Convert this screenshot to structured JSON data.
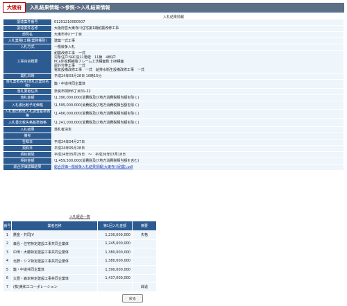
{
  "header": {
    "pref": "大阪府",
    "title": "入札結果情報->参照->入札結果情報"
  },
  "detail_section_title": "入札結果情報",
  "details": [
    {
      "label": "調達案件番号",
      "value": "01201210000507"
    },
    {
      "label": "調達案件名称",
      "value": "大阪府営大東寺川住宅第1期耐震改修工事"
    },
    {
      "label": "部局名",
      "value": "大東市寺川一丁目"
    },
    {
      "label": "入札業種(工種/業務種別)",
      "value": "建築一式工事"
    },
    {
      "label": "入札方式",
      "value": "一般競争入札"
    },
    {
      "label": "工事内容概要",
      "value": "耐震改修工事　一式\n対象住戸:SRC造11階建　11棟　480戸\nPCa外殻鋼補強フレーム工法構面数:198構面\n屋外付帯工事　一式\n電気設備改修工事　一式　給排水衛生設備改修工事　一式"
    },
    {
      "label": "開札日時",
      "value": "平成24年03月28日 10時15分"
    },
    {
      "label": "落札業者名称(落札企業体名称)",
      "value": "籠・中道共同企業体"
    },
    {
      "label": "落札業者住所",
      "value": "奈良市岡田6丁目31-22"
    },
    {
      "label": "落札金額",
      "value": "\\1,390,000,000(消費税及び地方消費税相当額を除く)"
    },
    {
      "label": "入札書比較予定価格",
      "value": "\\1,595,000,000(消費税及び地方消費税相当額を除く)"
    },
    {
      "label": "入札書比較低入札調査基準価格",
      "value": "\\1,406,000,000(消費税及び地方消費税相当額を除く)"
    },
    {
      "label": "入札書比較失格基準価格",
      "value": "\\1,241,000,000(消費税及び地方消費税相当額を除く)"
    },
    {
      "label": "入札結果",
      "value": "落札者決定"
    },
    {
      "label": "備考",
      "value": ""
    },
    {
      "label": "告知日",
      "value": "平成24年04月27日"
    },
    {
      "label": "契約日",
      "value": "平成24年05月28日"
    },
    {
      "label": "契約期間",
      "value": "平成24年05月29日　～　平成26年07月18日"
    },
    {
      "label": "契約金額",
      "value": "\\1,459,500,000(消費税及び地方消費税相当額を含む)"
    },
    {
      "label": "総合評価詳細結果",
      "value": "総合評価一般競争入札結果情報(大東寺川耐震).pdf",
      "link": true
    }
  ],
  "list_section_title": "入札経過一覧",
  "list": {
    "headers": {
      "no": "番号",
      "name": "業者名称",
      "amount": "第1回入札金額",
      "status": "摘要"
    },
    "rows": [
      {
        "no": "1",
        "name": "鷹金・共同JV",
        "amount": "1,230,000,000",
        "status": "失格"
      },
      {
        "no": "2",
        "name": "森島・住宅特定建設工事共同企業体",
        "amount": "1,245,000,000",
        "status": ""
      },
      {
        "no": "3",
        "name": "中田・大勝特定建設工事共同企業体",
        "amount": "1,380,000,000",
        "status": ""
      },
      {
        "no": "4",
        "name": "北野・シマ特定建設工事共同企業体",
        "amount": "1,380,000,000",
        "status": ""
      },
      {
        "no": "5",
        "name": "籠・中道共同企業体",
        "amount": "1,390,000,000",
        "status": ""
      },
      {
        "no": "6",
        "name": "大豊・森本特定建設工事共同企業体",
        "amount": "1,437,000,000",
        "status": ""
      },
      {
        "no": "7",
        "name": "(株)美和エコーポレーション",
        "amount": "",
        "status": "辞退"
      }
    ]
  },
  "back_button": "戻る"
}
